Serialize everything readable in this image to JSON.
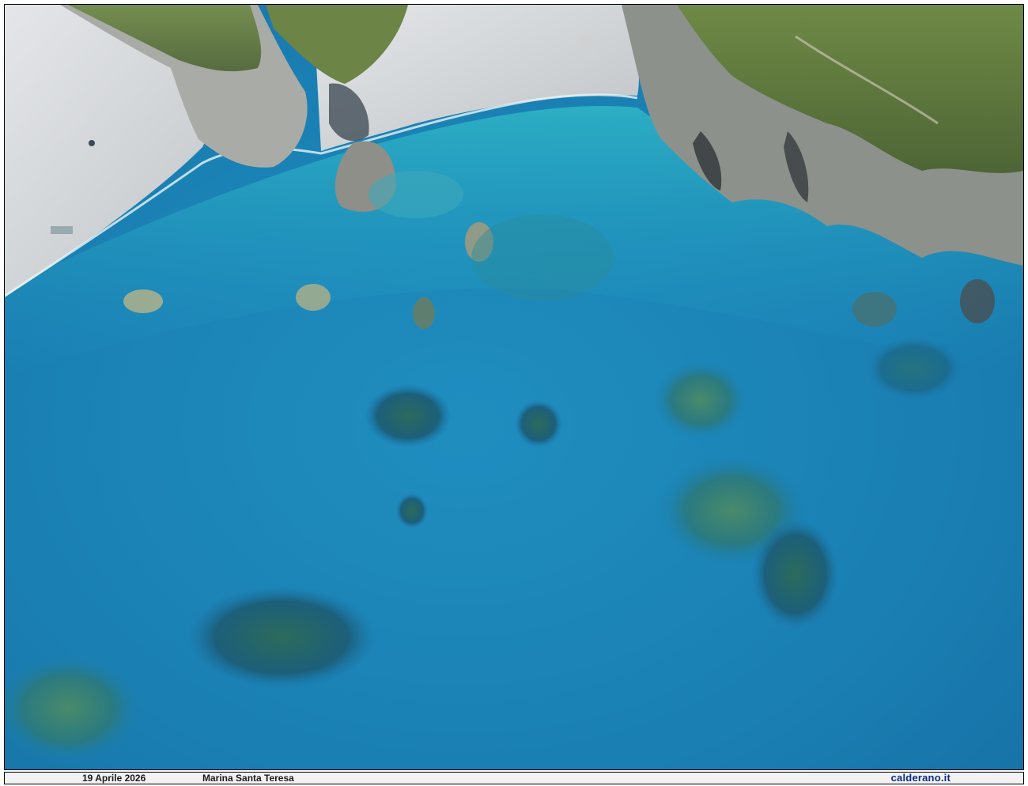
{
  "caption": {
    "date": "19 Aprile 2026",
    "place": "Marina Santa Teresa",
    "site": "calderano.it"
  },
  "photo": {
    "subject": "aerial-view-coastline",
    "colors": {
      "sea_deep": "#1a6fa6",
      "sea_mid": "#1f8fbf",
      "sea_shallow": "#2ab3c8",
      "reef": "#1f5f6a",
      "beach": "#d8dadd",
      "rock": "#9a9c98",
      "vegetation": "#5f7a3a"
    }
  }
}
